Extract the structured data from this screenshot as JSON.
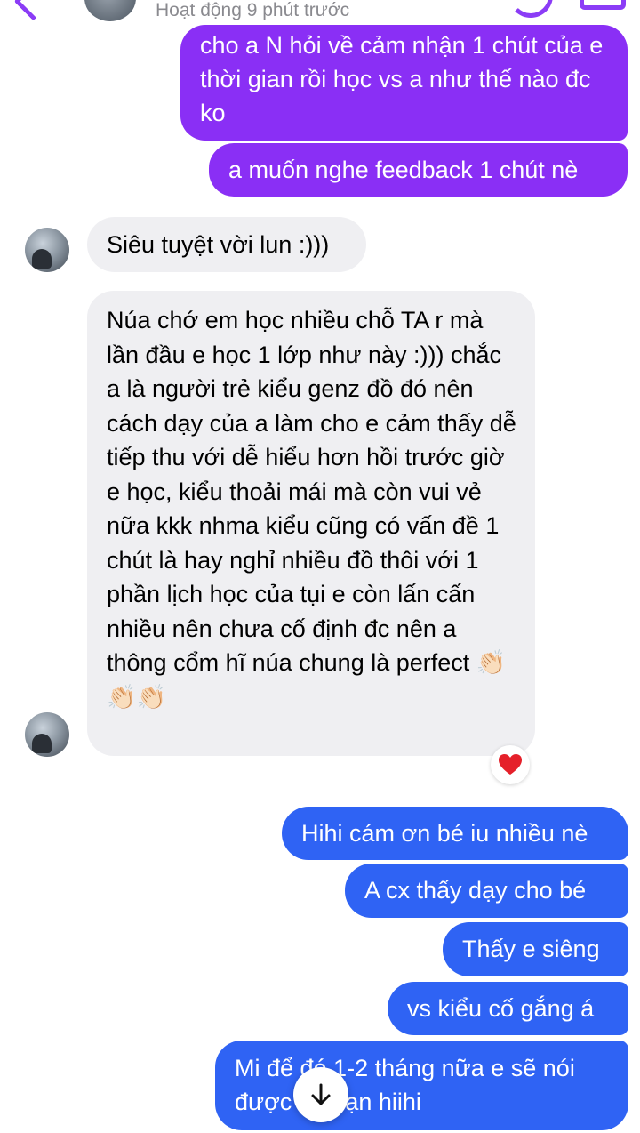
{
  "header": {
    "status": "Hoạt động 9 phút trước"
  },
  "messages": {
    "m1": "cho a N hỏi về cảm nhận 1 chút của e thời gian rồi học vs a như thế nào đc ko",
    "m2": "a muốn nghe feedback 1 chút nè",
    "m3": "Siêu tuyệt vời lun :)))",
    "m4": "Núa chớ em học nhiều chỗ TA r mà lần đầu e học 1 lớp như này :))) chắc a là người trẻ kiểu genz đồ đó nên cách dạy của a làm cho e cảm thấy dễ tiếp thu với dễ hiểu hơn hồi trước giờ e học, kiểu thoải mái mà còn vui vẻ nữa kkk nhma kiểu cũng có vấn đề 1 chút là hay nghỉ nhiều đồ thôi với 1 phần lịch học của tụi e còn lấn cấn nhiều nên chưa cố định đc nên a thông cổm hĩ núa chung là perfect 👏🏻👏🏻👏🏻",
    "o1": "Hihi cám ơn bé iu nhiều nè",
    "o2": "A cx thấy dạy cho bé",
    "o3": "Thấy e siêng",
    "o4": "vs kiểu cố gắng á",
    "o5": "Mi để đó 1-2 tháng nữa e sẽ nói được 1 đoạn hiihi"
  },
  "reaction": "❤️",
  "colors": {
    "purple_bubble": "#8a2ff5",
    "blue_bubble": "#2f63f4",
    "incoming_bubble": "#efeff2",
    "accent": "#8b3cf6",
    "heart": "#e5202a"
  },
  "icons": {
    "back": "chevron-left-icon",
    "call": "phone-icon",
    "video": "video-icon",
    "reaction": "heart-icon",
    "scroll": "arrow-down-icon"
  }
}
